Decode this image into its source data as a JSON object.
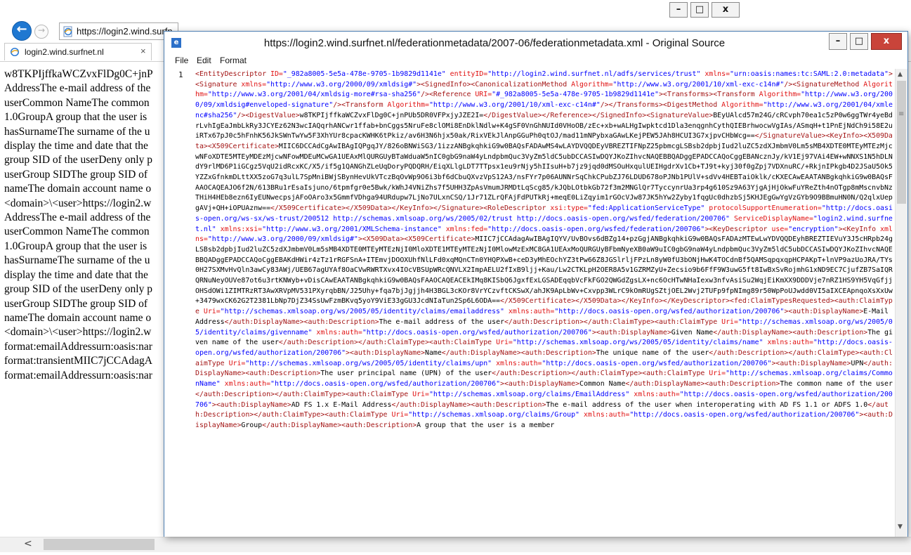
{
  "browser": {
    "address_url": "https://login2.wind.surfn",
    "tab_title": "login2.wind.surfnet.nl",
    "tab_close": "×",
    "back_glyph": "←",
    "forward_glyph": "→",
    "caption": {
      "minimize": "–",
      "maximize": "□",
      "close": "x"
    },
    "scroll_left_glyph": "<",
    "content_lines": [
      "w8TKPIjffkaWCZvxFlDg0C+jnP",
      "AddressThe e-mail address of the",
      "userCommon NameThe common",
      "1.0GroupA group that the user is",
      "hasSurnameThe surname of the u",
      "display the time and date that the",
      "group SID of the userDeny only p",
      "userGroup SIDThe group SID of",
      "nameThe domain account name o",
      "<domain>\\<user>https://login2.w",
      "AddressThe e-mail address of the",
      "userCommon NameThe common",
      "1.0GroupA group that the user is",
      "hasSurnameThe surname of the u",
      "display the time and date that the",
      "group SID of the userDeny only p",
      "userGroup SIDThe group SID of",
      "nameThe domain account name o",
      "<domain>\\<user>https://login2.w",
      "format:emailAddressurn:oasis:nar",
      "format:transientMIIC7jCCAdagA",
      "format:emailAddressurn:oasis:nar"
    ]
  },
  "source_window": {
    "title": "https://login2.wind.surfnet.nl/federationmetadata/2007-06/federationmetadata.xml - Original Source",
    "app_icon_glyph": "e",
    "caption": {
      "minimize": "–",
      "maximize": "□",
      "close": "x"
    },
    "menu": [
      "File",
      "Edit",
      "Format"
    ],
    "line_number": "1",
    "scroll_up_glyph": "▲",
    "scroll_down_glyph": "▼",
    "scroll_grip_glyph": "≡",
    "code_segments": [
      [
        "t",
        "<EntityDescriptor "
      ],
      [
        "a",
        "ID="
      ],
      [
        "v",
        "\"_982a8005-5e5a-478e-9705-1b9829d1141e\" "
      ],
      [
        "a",
        "entityID="
      ],
      [
        "v",
        "\"http://login2.wind.surfnet.nl/adfs/services/trust\" "
      ],
      [
        "a",
        "xmlns="
      ],
      [
        "v",
        "\"urn:oasis:names:tc:SAML:2.0:metadata\""
      ],
      [
        "t",
        "><Signature "
      ],
      [
        "a",
        "xmlns="
      ],
      [
        "v",
        "\"http://www.w3.org/2000/09/xmldsig#\""
      ],
      [
        "t",
        "><SignedInfo><CanonicalizationMethod "
      ],
      [
        "a",
        "Algorithm="
      ],
      [
        "v",
        "\"http://www.w3.org/2001/10/xml-exc-c14n#\""
      ],
      [
        "t",
        "/><SignatureMethod "
      ],
      [
        "a",
        "Algorithm="
      ],
      [
        "v",
        "\"http://www.w3.org/2001/04/xmldsig-more#rsa-sha256\""
      ],
      [
        "t",
        "/><Reference "
      ],
      [
        "a",
        "URI="
      ],
      [
        "v",
        "\"#_982a8005-5e5a-478e-9705-1b9829d1141e\""
      ],
      [
        "t",
        "><Transforms><Transform "
      ],
      [
        "a",
        "Algorithm="
      ],
      [
        "v",
        "\"http://www.w3.org/2000/09/xmldsig#enveloped-signature\""
      ],
      [
        "t",
        "/>"
      ],
      [
        "t",
        "<Transform "
      ],
      [
        "a",
        "Algorithm="
      ],
      [
        "v",
        "\"http://www.w3.org/2001/10/xml-exc-c14n#\""
      ],
      [
        "t",
        "/></Transforms><DigestMethod "
      ],
      [
        "a",
        "Algorithm="
      ],
      [
        "v",
        "\"http://www.w3.org/2001/04/xmlenc#sha256\""
      ],
      [
        "t",
        "/><DigestValue>"
      ],
      [
        "x",
        "w8TKPIjffkaWCZvxFlDg0C+jnPUb5DR0VFPxjyJZE2I="
      ],
      [
        "t",
        "</DigestValue></Reference>"
      ],
      [
        "t",
        "</SignedInfo><SignatureValue>"
      ],
      [
        "x",
        "BEyUAlcd57m24G/cRCvph70ea1c5zP0w6ggTWr4yeBdrLvhIgEaJmbLkRy3JCYEz62N3wcIAQqrhANCwr1ffab+bnCggs5NruFe8clOMi8EnDklNdlw+K4gSF0VnGhNUId0VHoOB/zEc+xb+wALHgIwpktcd1Dla3enqgnhCythQIEBrhwocwVgIAs/ASmqH+t1PnEjNdCh9i58E2uiRTx67pJ0c5hFnhK56JkSWnTwYw5F3XhYUr8cpacKWHK6tPkiz/av6H3N6hjx50ak/RixVEkJlAnpGGuPh0qtOJ/mad11mNPybxaGAwLKejPEW5JAh8HCUI3G7xjpvCHbWcg=="
      ],
      [
        "t",
        "</SignatureValue><KeyInfo><X509Data><X509Certificate>"
      ],
      [
        "x",
        "MIIC6DCCAdCgAwIBAgIQPgqJY/826oBNWiSG3/1izzANBgkqhkiG9w0BAQsFADAwMS4wLAYDVQQDEyVBREZTIFNpZ25pbmcgLSBsb2dpbjIud2luZC5zdXJmbmV0Lm5sMB4XDTE0MTEyMTEzMjcwNFoXDTE5MTEyMDEzMjcwNFowMDEuMCwGA1UEAxMlQURGUyBTaWduaW5nIC0gbG9naW4yLndpbmQuc3VyZm5ldC5ubDCCASIwDQYJKoZIhvcNAQEBBQADggEPADCCAQoCggEBANcznJy/kV1Ej97VAi4EW+wNNXS1N5hDLNdY9rlMD6P1iGCgz5VqU2idRcxKC/X5/if5g1QANGhZLeUqDoryPQDQRH/EiqXLlgLDT7TTpsx1eu9rNjy5hIIsuH+b7jz9jqd0dMSOuHxqulUEIHgdrXv1Cb+TJ9t+kyj30f0gZpj7VDXnuRC/+RkjnIPkgb4D2JSaU5Ok5YZZxGfnkmDLttXX5zoG7q3ulL7SpMniBWjSBynHevUkVTczBqOvWp9O6i3bf6dCbuQXvzVpS12A3/nsFYr7p06AUNNrSqChkCPubZJ76LDUD678oPJNb1PUlV+sdVv4HEBTaiOklk/cKXECAwEAATANBgkqhkiG9w0BAQsFAAOCAQEAJO6f2N/613BRu1rEsaIsjuno/6tpmfgr0e5Bwk/kWhJ4VNiZhs7f5UHH3ZpAsVmumJRMDtLqScg85/kJQbLOtbkGb72f3m2MNGlQr7TyccynrUa3rp4g610Sz9A63YjgAjHjOkwFuYReZth4nOTgp8mMscnvbNzTHiH4HEb8ezn6IyEUNwecpsjAFoOAro3x5GmmfVDhga94URdupw7LjNo7ULxnCSQ/1Jr71ZLrQFAjFdPUTkRj+meqE0LiZqyim1rGOcVJw87JK5hYw2Zyby1fqgUc0dhzbSj5KHJEgGwYgVzGYb9O9BBmuHN0N/Q2qlxUepgAVj+QH+iOPUAznw=="
      ],
      [
        "t",
        "</X509Certificate></X509Data>"
      ],
      [
        "t",
        "</KeyInfo></Signature><RoleDescriptor "
      ],
      [
        "a",
        "xsi:type="
      ],
      [
        "v",
        "\"fed:ApplicationServiceType\" "
      ],
      [
        "a",
        "protocolSupportEnumeration="
      ],
      [
        "v",
        "\"http://docs.oasis-open.org/ws-sx/ws-trust/200512 http://schemas.xmlsoap.org/ws/2005/02/trust http://docs.oasis-open.org/wsfed/federation/200706\" "
      ],
      [
        "a",
        "ServiceDisplayName="
      ],
      [
        "v",
        "\"login2.wind.surfnet.nl\" "
      ],
      [
        "a",
        "xmlns:xsi="
      ],
      [
        "v",
        "\"http://www.w3.org/2001/XMLSchema-instance\" "
      ],
      [
        "a",
        "xmlns:fed="
      ],
      [
        "v",
        "\"http://docs.oasis-open.org/wsfed/federation/200706\""
      ],
      [
        "t",
        "><KeyDescriptor "
      ],
      [
        "a",
        "use="
      ],
      [
        "v",
        "\"encryption\""
      ],
      [
        "t",
        "><KeyInfo "
      ],
      [
        "a",
        "xmlns="
      ],
      [
        "v",
        "\"http://www.w3.org/2000/09/xmldsig#\""
      ],
      [
        "t",
        "><X509Data>"
      ],
      [
        "t",
        "<X509Certificate>"
      ],
      [
        "x",
        "MIIC7jCCAdagAwIBAgIQYV/UvBOvs6dBZg14+pzGgjANBgkqhkiG9w0BAQsFADAzMTEwLwYDVQQDEyhBREZTIEVuY3J5cHRpb24gLSBsb2dpbjIud2luZC5zdXJmbmV0Lm5sMB4XDTE0MTEyMTEzNjI0MloXDTE1MTEyMTEzNjI0MlowMzExMC8GA1UEAxMoQURGUyBFbmNyeXB0aW9uIC0gbG9naW4yLndpbmQuc3VyZm5ldC5ubDCCASIwDQYJKoZIhvcNAQEBBQADggEPADCCAQoCggEBAKdHWir4zTz1rRGFSnA+ITEmvjDOOXUhfNlLFd0xqMQnCTn0YHQPXwB+ceD3yMhEOchYZ3tPw66Z8JGSlrljFPzLn8yW0fU3bONjHwK4TOCdnBf5QAMSqpqxqpHCPAKpT+lnVP9azUoJRA/TYs0H27SXMvHvQln3awCy83AWj/UEB67agUYAf8OaCVwRWRTXvx4IOcVBSUpWRcQNVLX2ImpAELU2fIxB9ljj+Kau/Lw2CTKLpH2OER8A5v1GZRMZyU+Zecsio9b6FfF9W3uwG5ft8IwBxSvRojmhG1xND9EC7CjufZB7SaIQRQRNuNeyOUVe87ot6u3rtKNWyb+vDisCAwEAATANBgkqhkiG9w0BAQsFAAOCAQEACEkIMq8KISbQ6JgxfExLGSADEqqbVcFkFGO2QWGdZgsLX+nc6OcHTwNHaIexw3nfvAsiSu2WqjEiKmXX9DDDVje7nRZ1HS9YH5VqGfjjOHSdOWi1ZIMTRzRT3AwXRVpMV531PXyrqbBN/J25Uhy+fqa7bjJgjjh4H3BGL3cKOr8VrYCzvftCKSwX/ahJK9ApLbWv+Cxvpp3WLrC9kOmRUgSZtjOEL2Wvj2TUFp9fpNImg89r50WpPoUJwdd0VI5aIXCEApnqoXsXxUw+3479wxCK62G2T2381LbNp7DjZ34SsUwFzmBKvq5yoY9ViE33gGU3JcdNIaTun2Sp6L6ODA=="
      ],
      [
        "t",
        "</X509Certificate></X509Data>"
      ],
      [
        "t",
        "</KeyInfo></KeyDescriptor><fed:ClaimTypesRequested><auth:ClaimType "
      ],
      [
        "a",
        "Uri="
      ],
      [
        "v",
        "\"http://schemas.xmlsoap.org/ws/2005/05/identity/claims/emailaddress\" "
      ],
      [
        "a",
        "xmlns:auth="
      ],
      [
        "v",
        "\"http://docs.oasis-open.org/wsfed/authorization/200706\""
      ],
      [
        "t",
        "><auth:DisplayName>"
      ],
      [
        "x",
        "E-Mail Address"
      ],
      [
        "t",
        "</auth:DisplayName><auth:Description>"
      ],
      [
        "x",
        "The e-mail address of the user"
      ],
      [
        "t",
        "</auth:Description></auth:ClaimType><auth:ClaimType "
      ],
      [
        "a",
        "Uri="
      ],
      [
        "v",
        "\"http://schemas.xmlsoap.org/ws/2005/05/identity/claims/givenname\" "
      ],
      [
        "a",
        "xmlns:auth="
      ],
      [
        "v",
        "\"http://docs.oasis-open.org/wsfed/authorization/200706\""
      ],
      [
        "t",
        "><auth:DisplayName>"
      ],
      [
        "x",
        "Given Name"
      ],
      [
        "t",
        "</auth:DisplayName><auth:Description>"
      ],
      [
        "x",
        "The given name of the user"
      ],
      [
        "t",
        "</auth:Description></auth:ClaimType><auth:ClaimType "
      ],
      [
        "a",
        "Uri="
      ],
      [
        "v",
        "\"http://schemas.xmlsoap.org/ws/2005/05/identity/claims/name\" "
      ],
      [
        "a",
        "xmlns:auth="
      ],
      [
        "v",
        "\"http://docs.oasis-open.org/wsfed/authorization/200706\""
      ],
      [
        "t",
        "><auth:DisplayName>"
      ],
      [
        "x",
        "Name"
      ],
      [
        "t",
        "</auth:DisplayName><auth:Description>"
      ],
      [
        "x",
        "The unique name of the user"
      ],
      [
        "t",
        "</auth:Description></auth:ClaimType><auth:ClaimType "
      ],
      [
        "a",
        "Uri="
      ],
      [
        "v",
        "\"http://schemas.xmlsoap.org/ws/2005/05/identity/claims/upn\" "
      ],
      [
        "a",
        "xmlns:auth="
      ],
      [
        "v",
        "\"http://docs.oasis-open.org/wsfed/authorization/200706\""
      ],
      [
        "t",
        "><auth:DisplayName>"
      ],
      [
        "x",
        "UPN"
      ],
      [
        "t",
        "</auth:DisplayName><auth:Description>"
      ],
      [
        "x",
        "The user principal name (UPN) of the user"
      ],
      [
        "t",
        "</auth:Description></auth:ClaimType>"
      ],
      [
        "t",
        "<auth:ClaimType "
      ],
      [
        "a",
        "Uri="
      ],
      [
        "v",
        "\"http://schemas.xmlsoap.org/claims/CommonName\" "
      ],
      [
        "a",
        "xmlns:auth="
      ],
      [
        "v",
        "\"http://docs.oasis-open.org/wsfed/authorization/200706\""
      ],
      [
        "t",
        "><auth:DisplayName>"
      ],
      [
        "x",
        "Common Name"
      ],
      [
        "t",
        "</auth:DisplayName><auth:Description>"
      ],
      [
        "x",
        "The common name of the user"
      ],
      [
        "t",
        "</auth:Description></auth:ClaimType>"
      ],
      [
        "t",
        "<auth:ClaimType "
      ],
      [
        "a",
        "Uri="
      ],
      [
        "v",
        "\"http://schemas.xmlsoap.org/claims/EmailAddress\" "
      ],
      [
        "a",
        "xmlns:auth="
      ],
      [
        "v",
        "\"http://docs.oasis-open.org/wsfed/authorization/200706\""
      ],
      [
        "t",
        "><auth:DisplayName>"
      ],
      [
        "x",
        "AD FS 1.x E-Mail Address"
      ],
      [
        "t",
        "</auth:DisplayName><auth:Description>"
      ],
      [
        "x",
        "The e-mail address of the user when interoperating with AD FS 1.1 or ADFS 1.0"
      ],
      [
        "t",
        "</auth:Description></auth:ClaimType><auth:ClaimType "
      ],
      [
        "a",
        "Uri="
      ],
      [
        "v",
        "\"http://schemas.xmlsoap.org/claims/Group\" "
      ],
      [
        "a",
        "xmlns:auth="
      ],
      [
        "v",
        "\"http://docs.oasis-open.org/wsfed/authorization/200706\""
      ],
      [
        "t",
        "><auth:DisplayName>"
      ],
      [
        "x",
        "Group"
      ],
      [
        "t",
        "</auth:DisplayName><auth:Description>"
      ],
      [
        "x",
        "A group that the user is a member"
      ]
    ]
  }
}
